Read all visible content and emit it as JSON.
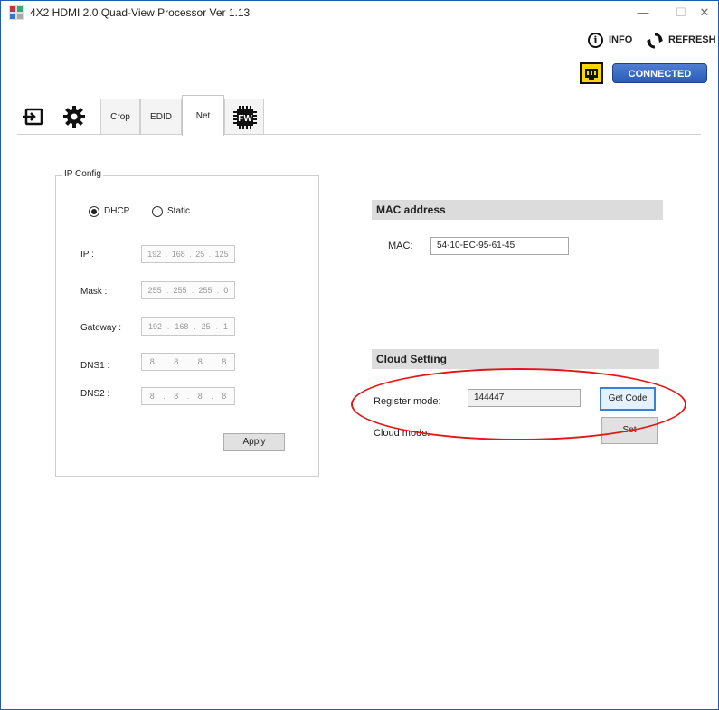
{
  "window": {
    "title": "4X2 HDMI 2.0 Quad-View Processor  Ver 1.13",
    "minimize_glyph": "—",
    "maximize_glyph": "☐",
    "close_glyph": "✕"
  },
  "header": {
    "info_label": "INFO",
    "refresh_label": "REFRESH",
    "connected_label": "CONNECTED",
    "info_glyph": "i"
  },
  "tabs": [
    {
      "label": "",
      "icon": "input-icon"
    },
    {
      "label": "",
      "icon": "gear-icon"
    },
    {
      "label": "Crop"
    },
    {
      "label": "EDID"
    },
    {
      "label": "Net",
      "active": true
    },
    {
      "label": "",
      "icon": "fw-chip-icon",
      "icon_text": "FW"
    }
  ],
  "ip_config": {
    "title": "IP Config",
    "dhcp_label": "DHCP",
    "static_label": "Static",
    "selected_mode": "DHCP",
    "ip_label": "IP :",
    "ip": [
      "192",
      "168",
      "25",
      "125"
    ],
    "mask_label": "Mask :",
    "mask": [
      "255",
      "255",
      "255",
      "0"
    ],
    "gateway_label": "Gateway :",
    "gateway": [
      "192",
      "168",
      "25",
      "1"
    ],
    "dns1_label": "DNS1 :",
    "dns1": [
      "8",
      "8",
      "8",
      "8"
    ],
    "dns2_label": "DNS2 :",
    "dns2": [
      "8",
      "8",
      "8",
      "8"
    ],
    "apply_label": "Apply"
  },
  "mac": {
    "header": "MAC address",
    "label": "MAC:",
    "value": "54-10-EC-95-61-45"
  },
  "cloud": {
    "header": "Cloud Setting",
    "register_label": "Register mode:",
    "register_value": "144447",
    "get_code_label": "Get Code",
    "cloud_mode_label": "Cloud mode:",
    "set_label": "Set"
  },
  "colors": {
    "connected": "#2a5cb8",
    "network_icon_bg": "#ffd600",
    "annotation": "#e01818",
    "section_header_bg": "#dcdcdc"
  }
}
